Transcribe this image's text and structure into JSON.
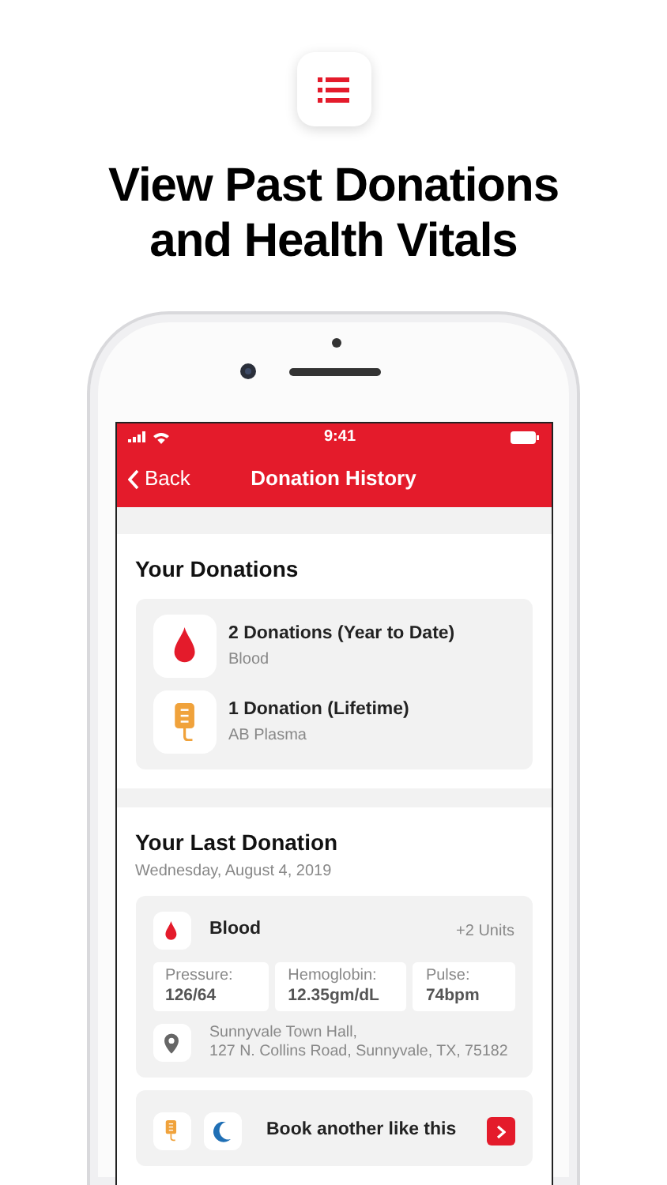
{
  "headline": "View Past Donations and Health Vitals",
  "status_bar": {
    "time": "9:41"
  },
  "nav": {
    "back": "Back",
    "title": "Donation History"
  },
  "your_donations": {
    "title": "Your Donations",
    "items": [
      {
        "kind": "blood",
        "title": "2 Donations (Year to Date)",
        "subtitle": "Blood"
      },
      {
        "kind": "plasma",
        "title": "1 Donation (Lifetime)",
        "subtitle": "AB Plasma"
      }
    ]
  },
  "last_donation": {
    "title": "Your Last Donation",
    "date": "Wednesday, August 4, 2019",
    "type": {
      "kind": "blood",
      "label": "Blood",
      "units": "+2 Units"
    },
    "vitals": [
      {
        "label": "Pressure:",
        "value": "126/64"
      },
      {
        "label": "Hemoglobin:",
        "value": "12.35gm/dL"
      },
      {
        "label": "Pulse:",
        "value": "74bpm"
      }
    ],
    "location": {
      "name": "Sunnyvale Town Hall,",
      "address": "127 N. Collins Road, Sunnyvale, TX, 75182"
    }
  },
  "book": {
    "label": "Book another like this"
  }
}
